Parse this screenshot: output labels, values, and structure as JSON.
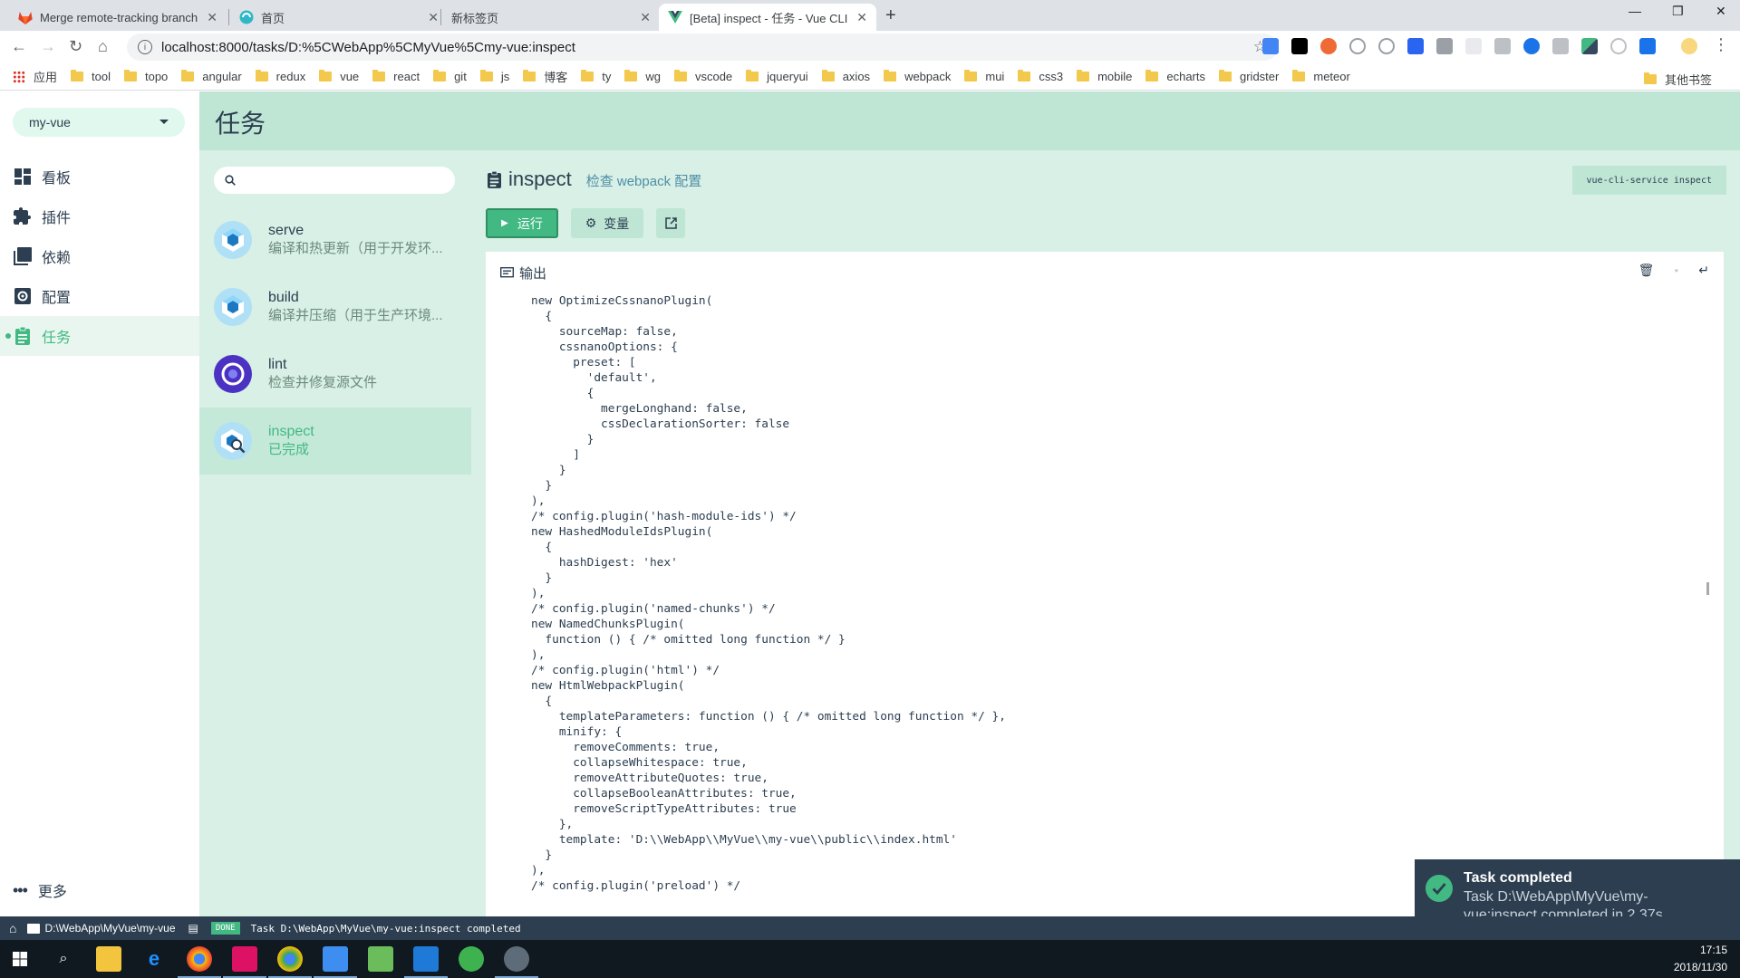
{
  "browser": {
    "tabs": [
      {
        "title": "Merge remote-tracking branch",
        "active": false
      },
      {
        "title": "首页",
        "active": false
      },
      {
        "title": "新标签页",
        "active": false
      },
      {
        "title": "[Beta] inspect - 任务 - Vue CLI",
        "active": true
      }
    ],
    "url": "localhost:8000/tasks/D:%5CWebApp%5CMyVue%5Cmy-vue:inspect",
    "bookmarks": [
      "应用",
      "tool",
      "topo",
      "angular",
      "redux",
      "vue",
      "react",
      "git",
      "js",
      "博客",
      "ty",
      "wg",
      "vscode",
      "jqueryui",
      "axios",
      "webpack",
      "mui",
      "css3",
      "mobile",
      "echarts",
      "gridster",
      "meteor"
    ],
    "other_bookmarks": "其他书签"
  },
  "sidebar": {
    "project": "my-vue",
    "items": [
      {
        "label": "看板",
        "icon": "dashboard-icon"
      },
      {
        "label": "插件",
        "icon": "puzzle-icon"
      },
      {
        "label": "依赖",
        "icon": "library-icon"
      },
      {
        "label": "配置",
        "icon": "settings-icon"
      },
      {
        "label": "任务",
        "icon": "assignment-icon",
        "active": true
      }
    ],
    "more": "更多"
  },
  "header": {
    "title": "任务"
  },
  "tasks": [
    {
      "name": "serve",
      "desc": "编译和热更新（用于开发环..."
    },
    {
      "name": "build",
      "desc": "编译并压缩（用于生产环境..."
    },
    {
      "name": "lint",
      "desc": "检查并修复源文件"
    },
    {
      "name": "inspect",
      "desc": "已完成",
      "active": true
    }
  ],
  "detail": {
    "name": "inspect",
    "desc": "检查 webpack 配置",
    "command": "vue-cli-service inspect",
    "run_label": "运行",
    "vars_label": "变量",
    "output_label": "输出",
    "code": "new OptimizeCssnanoPlugin(\n  {\n    sourceMap: false,\n    cssnanoOptions: {\n      preset: [\n        'default',\n        {\n          mergeLonghand: false,\n          cssDeclarationSorter: false\n        }\n      ]\n    }\n  }\n),\n/* config.plugin('hash-module-ids') */\nnew HashedModuleIdsPlugin(\n  {\n    hashDigest: 'hex'\n  }\n),\n/* config.plugin('named-chunks') */\nnew NamedChunksPlugin(\n  function () { /* omitted long function */ }\n),\n/* config.plugin('html') */\nnew HtmlWebpackPlugin(\n  {\n    templateParameters: function () { /* omitted long function */ },\n    minify: {\n      removeComments: true,\n      collapseWhitespace: true,\n      removeAttributeQuotes: true,\n      collapseBooleanAttributes: true,\n      removeScriptTypeAttributes: true\n    },\n    template: 'D:\\\\WebApp\\\\MyVue\\\\my-vue\\\\public\\\\index.html'\n  }\n),\n/* config.plugin('preload') */"
  },
  "toast": {
    "title": "Task completed",
    "message": "Task D:\\WebApp\\MyVue\\my-vue:inspect completed in 2.37s."
  },
  "statusbar": {
    "path": "D:\\WebApp\\MyVue\\my-vue",
    "badge": "DONE",
    "message": "Task D:\\WebApp\\MyVue\\my-vue:inspect completed"
  },
  "taskbar": {
    "time": "17:15",
    "date": "2018/11/30"
  },
  "colors": {
    "accent": "#42b983",
    "header": "#bfe6d5",
    "panel": "#d8f0e5",
    "dark": "#2c3e50"
  }
}
